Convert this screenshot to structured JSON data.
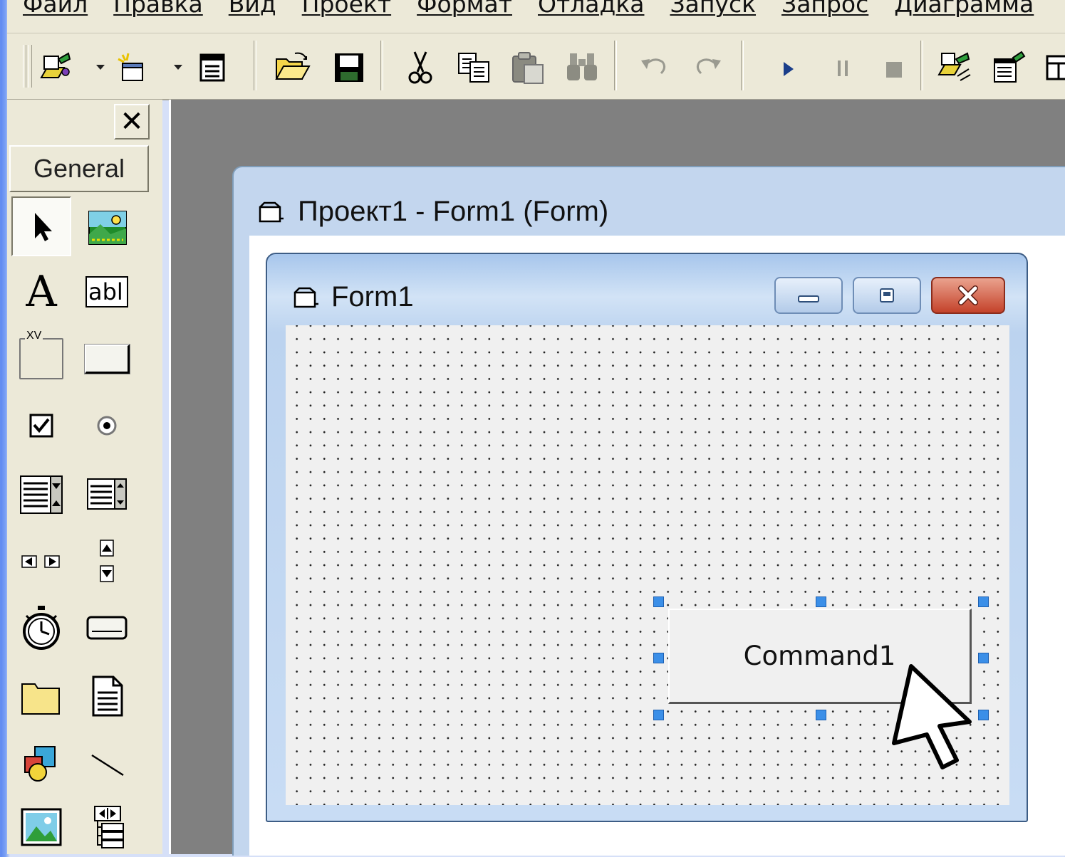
{
  "menu": {
    "items": [
      "Файл",
      "Правка",
      "Вид",
      "Проект",
      "Формат",
      "Отладка",
      "Запуск",
      "Запрос",
      "Диаграмма"
    ]
  },
  "toolbar": {
    "buttons": [
      "add-project",
      "add-form",
      "menu-editor",
      "open-project",
      "save-project",
      "cut",
      "copy",
      "paste",
      "find",
      "undo",
      "redo",
      "start",
      "break",
      "end",
      "project-explorer",
      "properties-window",
      "form-layout"
    ]
  },
  "toolbox": {
    "tab_label": "General",
    "close_glyph": "✕",
    "tools": [
      "pointer",
      "picturebox",
      "label",
      "textbox",
      "frame",
      "commandbutton",
      "checkbox",
      "optionbutton",
      "combobox",
      "listbox",
      "hscrollbar",
      "vscrollbar",
      "timer",
      "drivelistbox",
      "dirlistbox",
      "filelistbox",
      "shape",
      "line",
      "image",
      "data"
    ],
    "frame_caption": "XV",
    "textbox_caption": "abl",
    "label_caption": "A"
  },
  "project_window": {
    "title": "Проект1 - Form1 (Form)"
  },
  "form": {
    "title": "Form1",
    "command_button_label": "Command1"
  },
  "colors": {
    "accent_blue": "#3b8fe8",
    "form_border": "#3d5d85",
    "close_red": "#c4422a",
    "workspace_gray": "#808080"
  }
}
